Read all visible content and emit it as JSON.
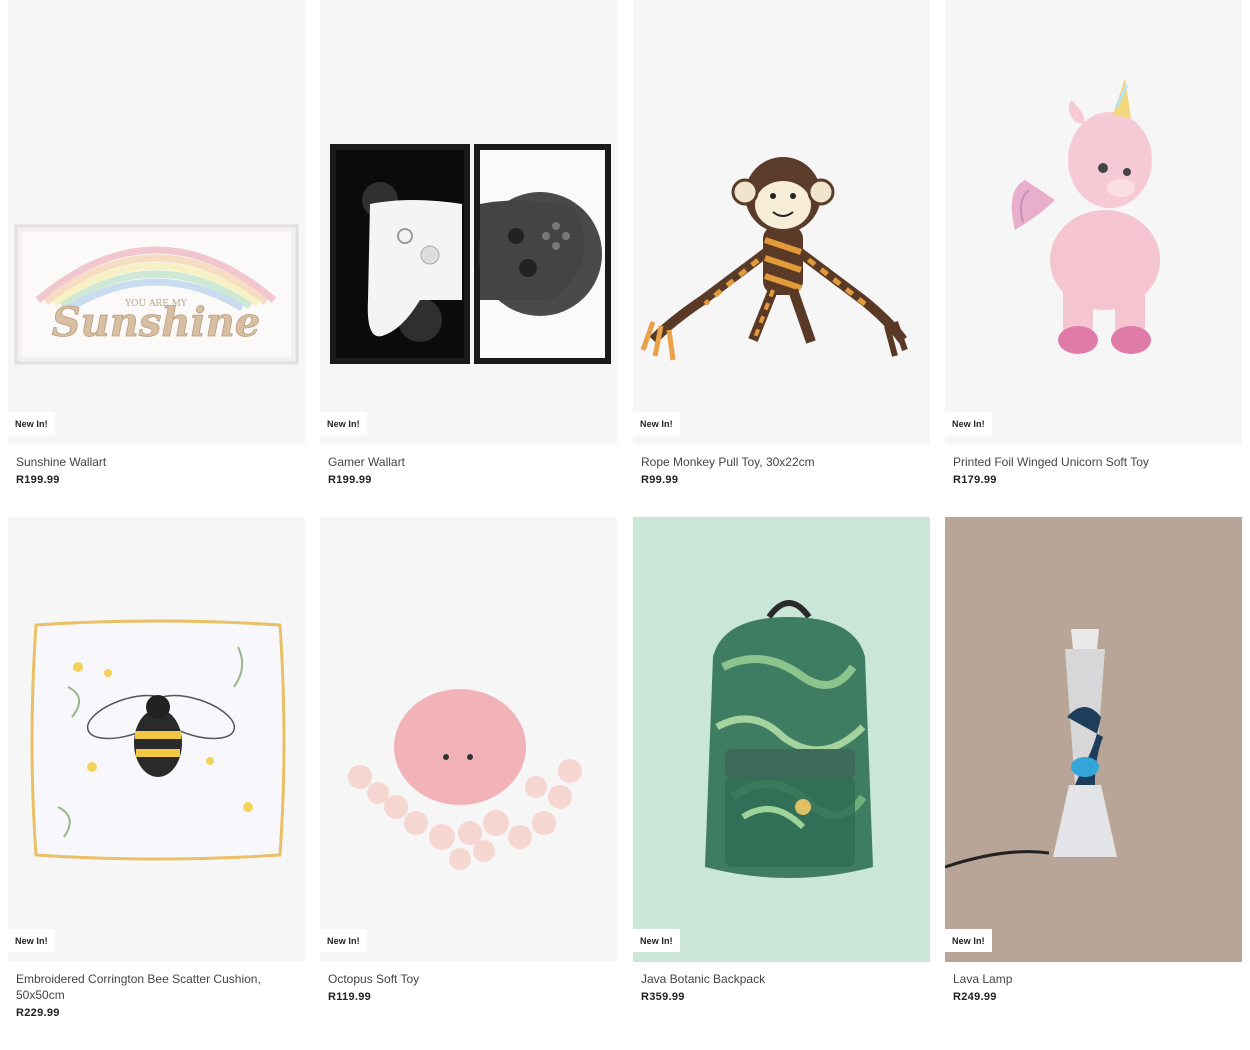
{
  "badge_label": "New In!",
  "products": [
    {
      "name": "Sunshine Wallart",
      "price": "R199.99",
      "art_text_top": "YOU ARE MY",
      "art_text_main": "Sunshine"
    },
    {
      "name": "Gamer Wallart",
      "price": "R199.99"
    },
    {
      "name": "Rope Monkey Pull Toy, 30x22cm",
      "price": "R99.99"
    },
    {
      "name": "Printed Foil Winged Unicorn Soft Toy",
      "price": "R179.99"
    },
    {
      "name": "Embroidered Corrington Bee Scatter Cushion, 50x50cm",
      "price": "R229.99"
    },
    {
      "name": "Octopus Soft Toy",
      "price": "R119.99"
    },
    {
      "name": "Java Botanic Backpack",
      "price": "R359.99"
    },
    {
      "name": "Lava Lamp",
      "price": "R249.99"
    }
  ],
  "colors": {
    "image_bg": "#f6f6f6",
    "backpack_bg": "#c9e6d9",
    "lamp_bg": "#b8a597"
  }
}
